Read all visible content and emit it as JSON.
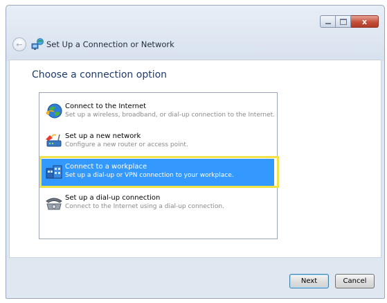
{
  "window": {
    "title": "Set Up a Connection or Network",
    "close_glyph": "x"
  },
  "nav": {
    "back_glyph": "←"
  },
  "main": {
    "heading": "Choose a connection option",
    "options": [
      {
        "title": "Connect to the Internet",
        "description": "Set up a wireless, broadband, or dial-up connection to the Internet.",
        "icon": "globe-icon",
        "selected": false
      },
      {
        "title": "Set up a new network",
        "description": "Configure a new router or access point.",
        "icon": "network-router-icon",
        "selected": false
      },
      {
        "title": "Connect to a workplace",
        "description": "Set up a dial-up or VPN connection to your workplace.",
        "icon": "workplace-icon",
        "selected": true
      },
      {
        "title": "Set up a dial-up connection",
        "description": "Connect to the Internet using a dial-up connection.",
        "icon": "dialup-phone-icon",
        "selected": false
      }
    ]
  },
  "footer": {
    "next_label": "Next",
    "cancel_label": "Cancel"
  },
  "colors": {
    "selection": "#3399ff",
    "highlight_outline": "#f2e24a",
    "heading": "#1e3b6a"
  }
}
